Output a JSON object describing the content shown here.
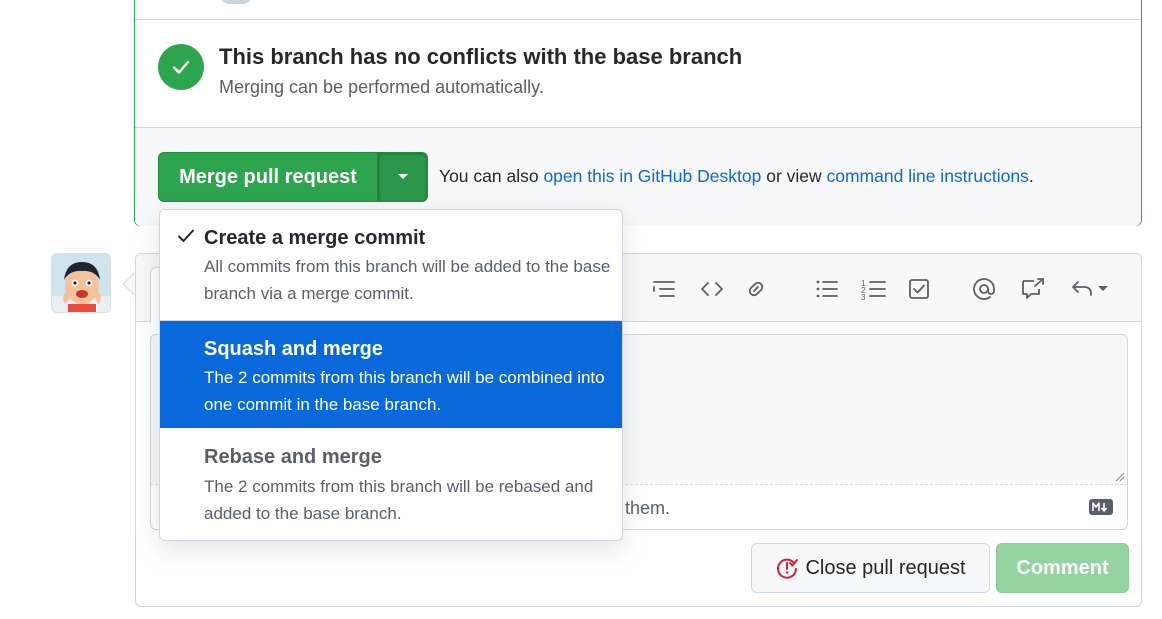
{
  "status": {
    "title": "This branch has no conflicts with the base branch",
    "subtitle": "Merging can be performed automatically."
  },
  "merge": {
    "button_label": "Merge pull request",
    "also_prefix": "You can also ",
    "desktop_link": "open this in GitHub Desktop",
    "also_middle": " or view ",
    "cli_link": "command line instructions",
    "also_suffix": "."
  },
  "menu": {
    "items": [
      {
        "title": "Create a merge commit",
        "description": "All commits from this branch will be added to the base branch via a merge commit.",
        "selected": true,
        "highlighted": false
      },
      {
        "title": "Squash and merge",
        "description": "The 2 commits from this branch will be combined into one commit in the base branch.",
        "selected": false,
        "highlighted": true
      },
      {
        "title": "Rebase and merge",
        "description": "The 2 commits from this branch will be rebased and added to the base branch.",
        "selected": false,
        "highlighted": false
      }
    ]
  },
  "comment": {
    "attach_hint_visible": "ting them.",
    "close_label": "Close pull request",
    "comment_label": "Comment"
  },
  "toolbar": {
    "icons": [
      "task-list-icon",
      "code-icon",
      "link-icon",
      "unordered-list-icon",
      "ordered-list-icon",
      "checklist-icon",
      "mention-icon",
      "cross-reference-icon",
      "reply-icon"
    ]
  },
  "colors": {
    "success": "#2da44e",
    "accent_blue": "#0969da",
    "comment_disabled": "#94d3a2",
    "danger": "#cf222e"
  }
}
